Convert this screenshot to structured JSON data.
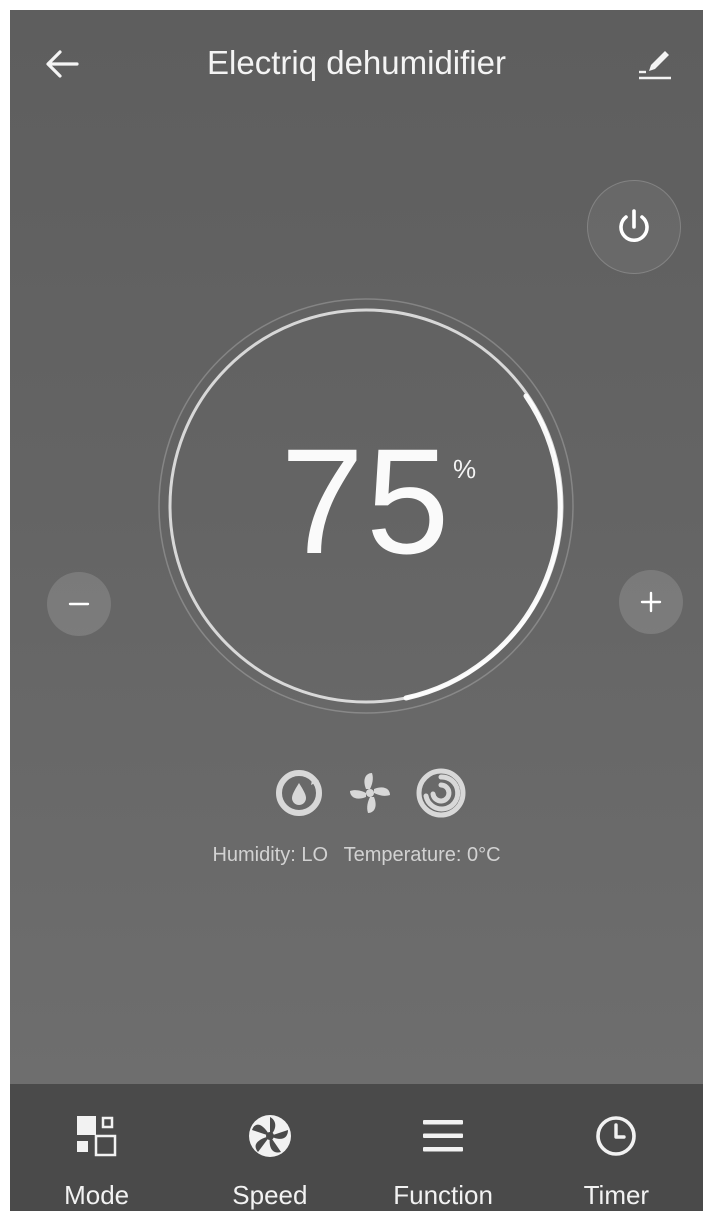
{
  "header": {
    "title": "Electriq dehumidifier",
    "back_icon": "back-arrow-icon",
    "edit_icon": "edit-pencil-icon"
  },
  "power": {
    "icon": "power-icon"
  },
  "dial": {
    "humidity_value": "75",
    "unit": "%",
    "minus_icon": "minus-icon",
    "plus_icon": "plus-icon"
  },
  "status": {
    "icons": [
      "dehumidify-mode-icon",
      "fan-icon",
      "swirl-icon"
    ],
    "humidity": "Humidity: LO",
    "temperature": "Temperature: 0°C"
  },
  "tabs": [
    {
      "label": "Mode",
      "icon": "mode-grid-icon"
    },
    {
      "label": "Speed",
      "icon": "fan-speed-icon"
    },
    {
      "label": "Function",
      "icon": "menu-lines-icon"
    },
    {
      "label": "Timer",
      "icon": "clock-icon"
    }
  ],
  "colors": {
    "background_top": "#5e5e5e",
    "background_bottom": "#707070",
    "tab_bar": "#4a4a4a",
    "foreground": "#ffffff"
  }
}
